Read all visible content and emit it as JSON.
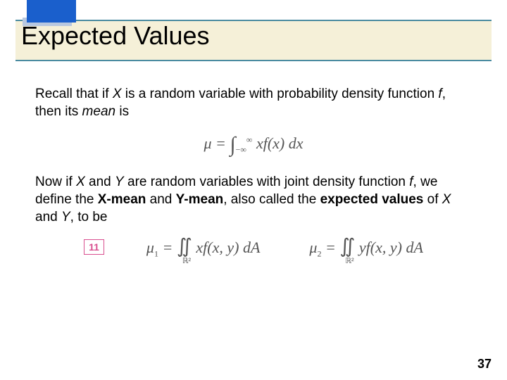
{
  "title": "Expected Values",
  "para1_a": "Recall that if ",
  "para1_b": " is a random variable with probability density function ",
  "para1_c": ", then its ",
  "para1_d": " is",
  "var_X": "X",
  "var_f": "f",
  "word_mean": "mean",
  "eq1": "μ = ∫ xf(x) dx",
  "eq1_lo": "−∞",
  "eq1_hi": "∞",
  "para2_a": "Now if ",
  "para2_b": " and ",
  "para2_c": " are random variables with joint density function ",
  "para2_d": ", we define the ",
  "para2_e": " and ",
  "para2_f": ", also called the ",
  "para2_g": " of ",
  "para2_h": " and ",
  "para2_i": ", to be",
  "var_Y": "Y",
  "xmean": "X-mean",
  "ymean": "Y-mean",
  "expected_values": "expected values",
  "badge": "11",
  "eq2a_lhs": "μ",
  "eq2a_sub": "1",
  "eq2a_rhs": " xf(x, y) dA",
  "eq2b_lhs": "μ",
  "eq2b_sub": "2",
  "eq2b_rhs": " yf(x, y) dA",
  "region": "ℝ²",
  "page": "37"
}
